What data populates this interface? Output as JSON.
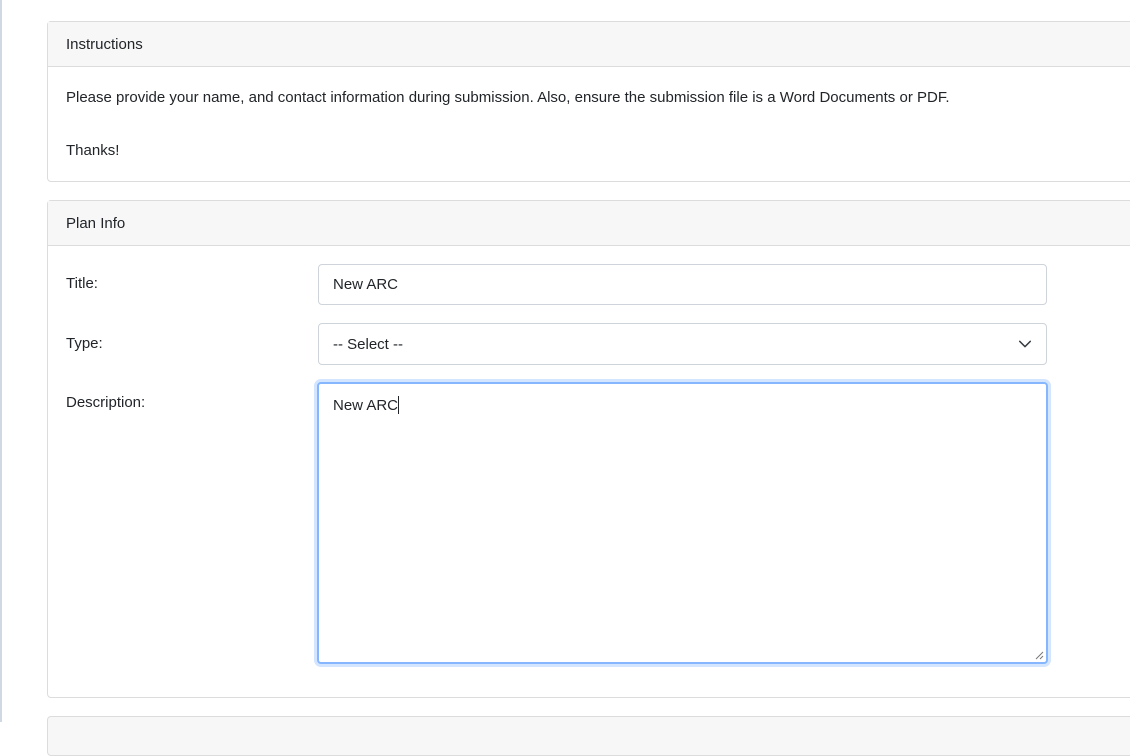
{
  "instructions": {
    "header": "Instructions",
    "paragraph": "Please provide your name, and contact information during submission. Also, ensure the submission file is a Word Documents or PDF.",
    "closing": "Thanks!"
  },
  "plan_info": {
    "header": "Plan Info",
    "title": {
      "label": "Title:",
      "value": "New ARC"
    },
    "type": {
      "label": "Type:",
      "selected": "-- Select --",
      "icon": "chevron-down-icon"
    },
    "description": {
      "label": "Description:",
      "value": "New ARC",
      "focused": true
    }
  },
  "colors": {
    "focus_border": "#86b7fe",
    "header_bg": "#f7f7f7",
    "border": "#dcdcdc"
  }
}
